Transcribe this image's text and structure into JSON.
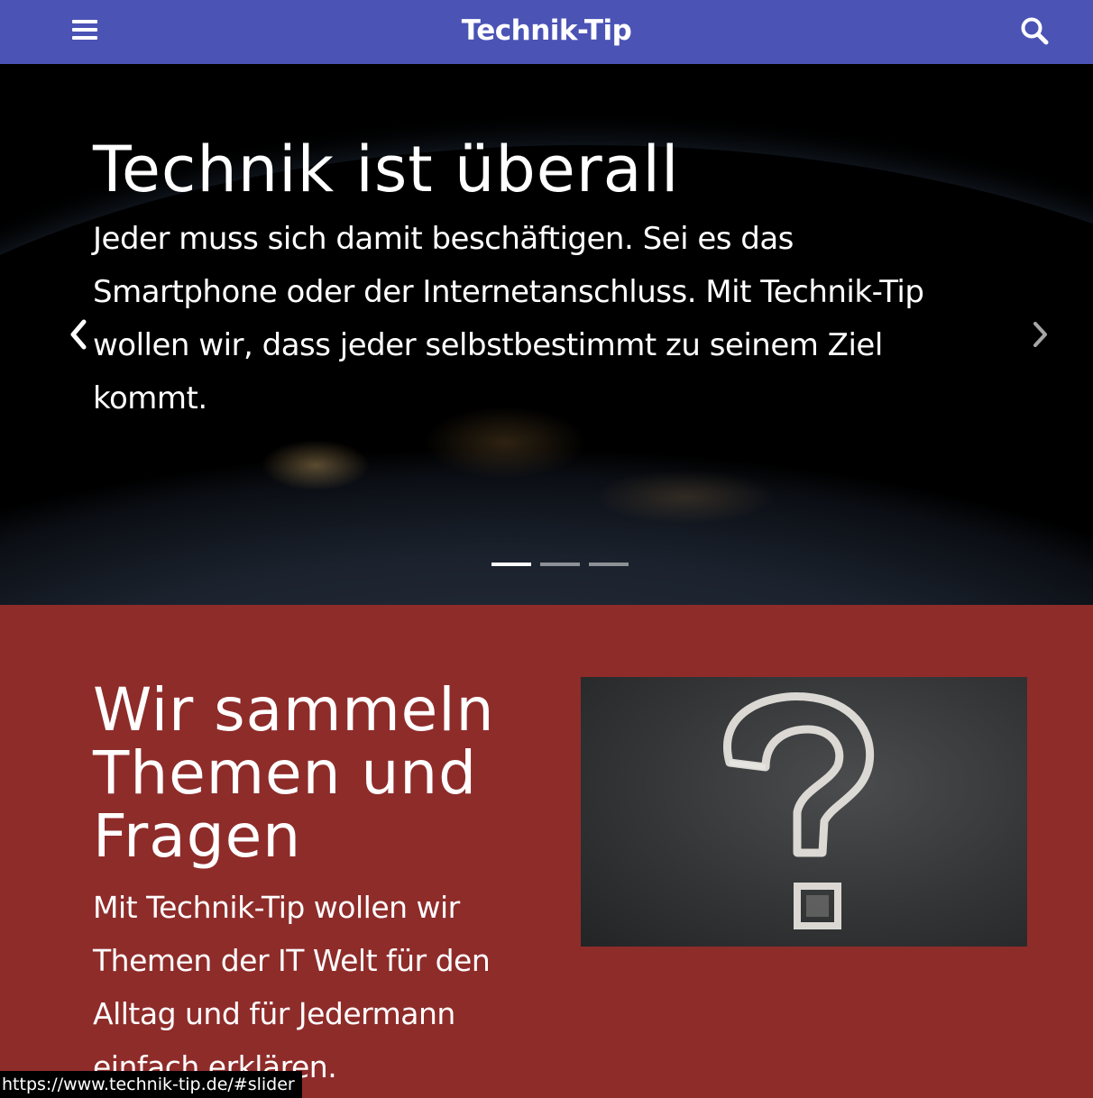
{
  "header": {
    "brand": "Technik-Tip",
    "color": "#4b53b5",
    "menu_icon": "hamburger-menu-icon",
    "search_icon": "search-icon"
  },
  "slider": {
    "title": "Technik ist überall",
    "text": "Jeder muss sich damit beschäftigen. Sei es das Smartphone oder der Internetanschluss. Mit Technik-Tip wollen wir, dass jeder selbstbestimmt zu seinem Ziel kommt.",
    "slide_count": 3,
    "active_slide": 1,
    "prev_icon": "chevron-left-icon",
    "next_icon": "chevron-right-icon"
  },
  "about": {
    "title": "Wir sammeln Themen und Fragen",
    "text": "Mit Technik-Tip wollen wir Themen der IT Welt für den Alltag und für Jedermann einfach erklären.",
    "background": "#8e2c2a",
    "image_icon": "question-mark-chalkboard-icon"
  },
  "status_bar": {
    "url": "https://www.technik-tip.de/#slider"
  }
}
